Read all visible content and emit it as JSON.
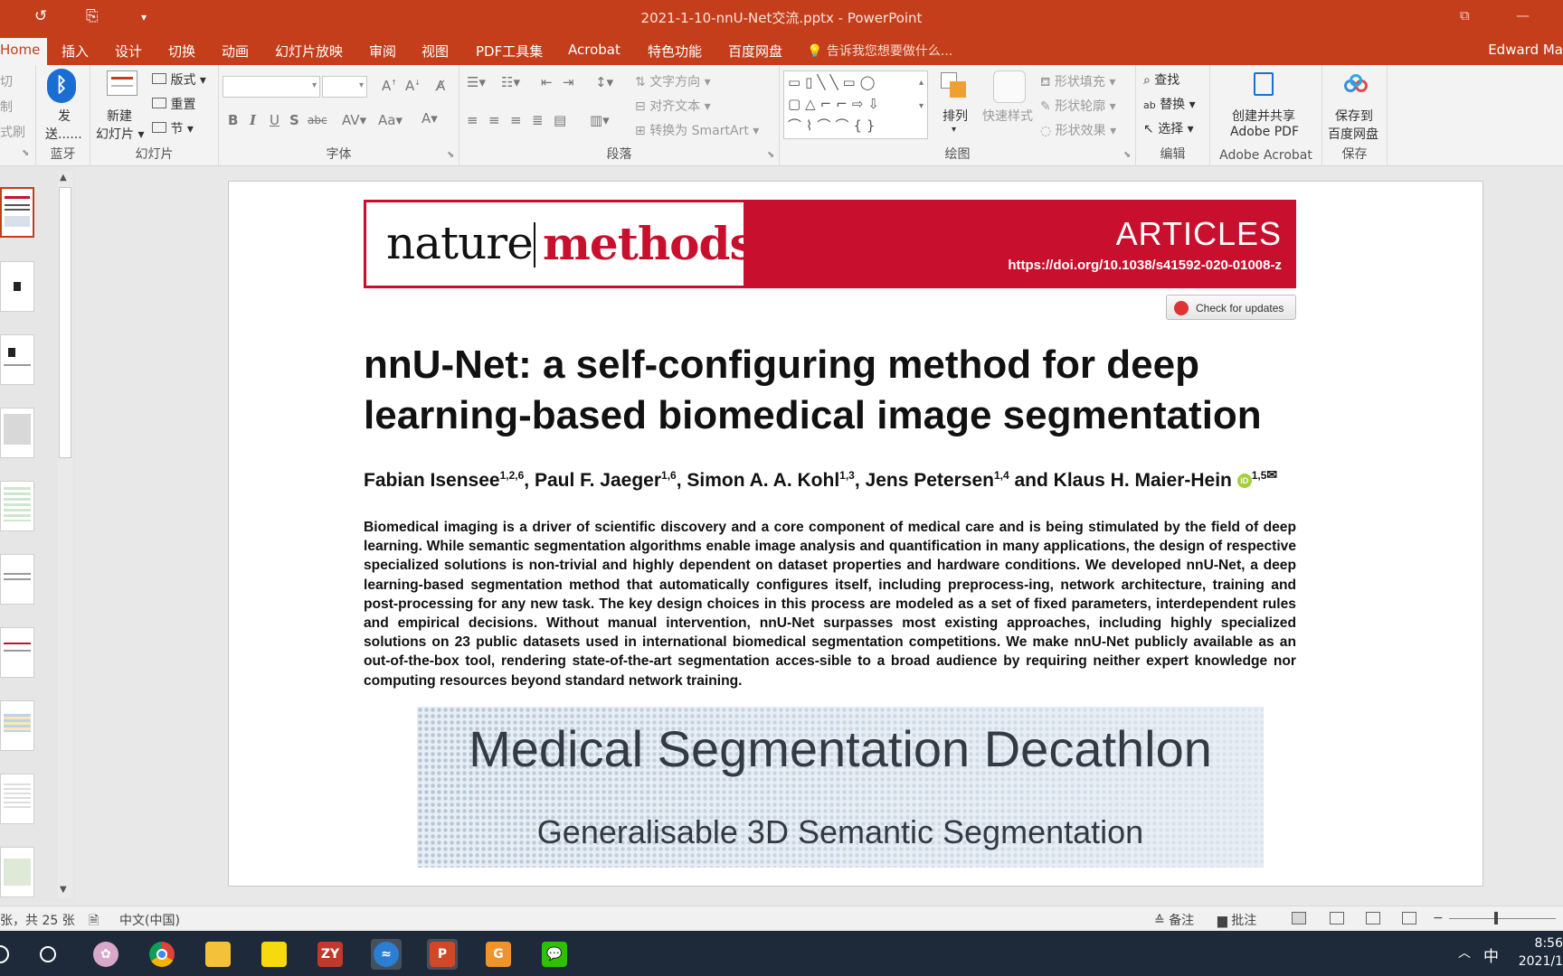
{
  "window": {
    "title": "2021-1-10-nnU-Net交流.pptx - PowerPoint"
  },
  "menu": {
    "tabs": [
      "Home",
      "插入",
      "设计",
      "切换",
      "动画",
      "幻灯片放映",
      "审阅",
      "视图",
      "PDF工具集",
      "Acrobat",
      "特色功能",
      "百度网盘"
    ],
    "active": "Home",
    "tell_me": "告诉我您想要做什么...",
    "user": "Edward Ma"
  },
  "ribbon": {
    "clipboard": {
      "cut": "切",
      "copy": "制",
      "format_painter": "式刷"
    },
    "bluetooth": {
      "label": "发送......",
      "label1": "发",
      "label2": "送......",
      "group": "蓝牙"
    },
    "slides": {
      "new_slide1": "新建",
      "new_slide2": "幻灯片",
      "layout": "版式",
      "reset": "重置",
      "section": "节",
      "group": "幻灯片"
    },
    "font": {
      "group": "字体"
    },
    "paragraph": {
      "text_direction": "文字方向",
      "align_text": "对齐文本",
      "smartart": "转换为 SmartArt",
      "group": "段落"
    },
    "drawing": {
      "arrange": "排列",
      "quick_styles": "快速样式",
      "shape_fill": "形状填充",
      "shape_outline": "形状轮廓",
      "shape_effects": "形状效果",
      "group": "绘图"
    },
    "editing": {
      "find": "查找",
      "replace": "替换",
      "select": "选择",
      "group": "编辑"
    },
    "acrobat": {
      "create1": "创建并共享",
      "create2": "Adobe PDF",
      "group": "Adobe Acrobat"
    },
    "save": {
      "save1": "保存到",
      "save2": "百度网盘",
      "group": "保存"
    }
  },
  "slide": {
    "journal_left": "nature",
    "journal_right": "methods",
    "section": "ARTICLES",
    "doi": "https://doi.org/10.1038/s41592-020-01008-z",
    "check_updates": "Check for updates",
    "title": "nnU-Net: a self-configuring method for deep learning-based biomedical image segmentation",
    "authors": [
      {
        "name": "Fabian Isensee",
        "sup": "1,2,6",
        "sep": ", "
      },
      {
        "name": "Paul F. Jaeger",
        "sup": "1,6",
        "sep": ", "
      },
      {
        "name": "Simon A. A. Kohl",
        "sup": "1,3",
        "sep": ", "
      },
      {
        "name": "Jens Petersen",
        "sup": "1,4",
        "sep": " and "
      },
      {
        "name": "Klaus H. Maier-Hein",
        "sup": "1,5",
        "sep": ""
      }
    ],
    "abstract": "Biomedical imaging is a driver of scientific discovery and a core component of medical care and is being stimulated by the field of deep learning. While semantic segmentation algorithms enable image analysis and quantification in many applications, the design of respective specialized solutions is non-trivial and highly dependent on dataset properties and hardware conditions. We developed nnU-Net, a deep learning-based segmentation method that automatically configures itself, including preprocess-ing, network architecture, training and post-processing for any new task. The key design choices in this process are modeled as a set of fixed parameters, interdependent rules and empirical decisions. Without manual intervention, nnU-Net surpasses most existing approaches, including highly specialized solutions on 23 public datasets used in international biomedical segmentation competitions. We make nnU-Net publicly available as an out-of-the-box tool, rendering state-of-the-art segmentation acces-sible to a broad audience by requiring neither expert knowledge nor computing resources beyond standard network training.",
    "banner_title": "Medical Segmentation Decathlon",
    "banner_subtitle": "Generalisable 3D Semantic Segmentation"
  },
  "status": {
    "slide_count": "张，共 25 张",
    "language": "中文(中国)",
    "notes": "备注",
    "comments": "批注"
  },
  "taskbar": {
    "ime": "中",
    "time": "8:56",
    "date": "2021/1"
  },
  "colors": {
    "accent": "#c43e1c",
    "nature_red": "#c8102e"
  }
}
